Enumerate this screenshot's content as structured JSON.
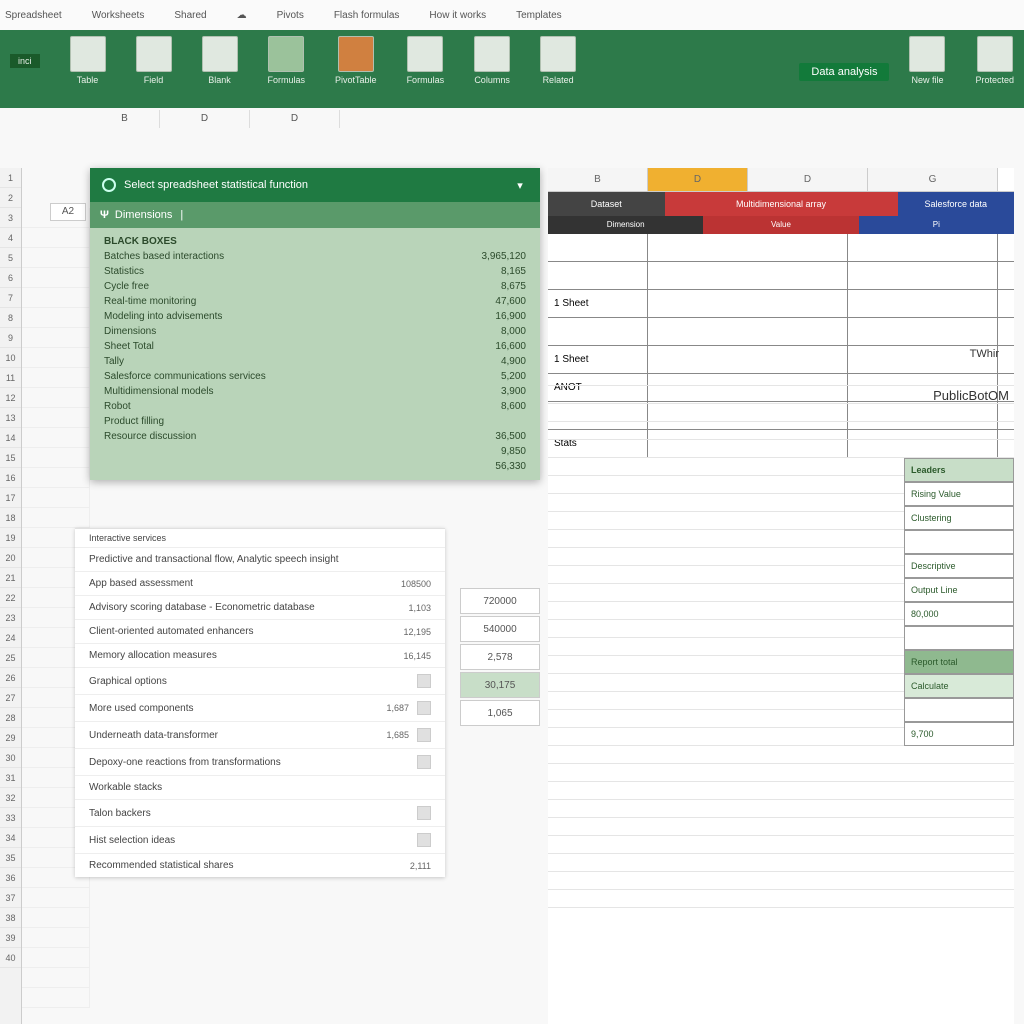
{
  "tabs": [
    "Spreadsheet",
    "Worksheets",
    "Shared",
    "",
    "Pivots",
    "Flash formulas",
    "How it works",
    "Templates"
  ],
  "ribbon": {
    "groups": [
      "Table",
      "Field",
      "Blank",
      "Formulas",
      "PivotTable",
      "Formulas",
      "Columns",
      "Related"
    ],
    "tag": "Data analysis",
    "right_groups": [
      "New file",
      "Protected"
    ]
  },
  "colrow": [
    "B",
    "D",
    "D"
  ],
  "cellref": "A2",
  "dialog": {
    "title": "Select spreadsheet statistical function",
    "filter": "Dimensions",
    "rows": [
      {
        "lbl": "BLACK BOXES",
        "val": ""
      },
      {
        "lbl": "Batches based interactions",
        "val": "3,965,120"
      },
      {
        "lbl": "Statistics",
        "val": "8,165"
      },
      {
        "lbl": "Cycle free",
        "val": "8,675"
      },
      {
        "lbl": "Real-time monitoring",
        "val": "47,600"
      },
      {
        "lbl": "Modeling into advisements",
        "val": "16,900"
      },
      {
        "lbl": "Dimensions",
        "val": "8,000"
      },
      {
        "lbl": "Sheet Total",
        "val": "16,600"
      },
      {
        "lbl": "Tally",
        "val": "4,900"
      },
      {
        "lbl": "Salesforce communications services",
        "val": "5,200"
      },
      {
        "lbl": "Multidimensional models",
        "val": "3,900"
      },
      {
        "lbl": "Robot",
        "val": "8,600"
      },
      {
        "lbl": "Product filling",
        "val": ""
      },
      {
        "lbl": "Resource discussion",
        "val": "36,500"
      },
      {
        "lbl": "",
        "val": "9,850"
      },
      {
        "lbl": "",
        "val": "56,330"
      }
    ]
  },
  "lowerlist": {
    "title": "Interactive services",
    "subtitle": "Predictive and transactional flow, Analytic speech insight",
    "items": [
      {
        "txt": "App based assessment",
        "num": "108500"
      },
      {
        "txt": "Advisory scoring database - Econometric database",
        "num": "1,103"
      },
      {
        "txt": "Client-oriented automated enhancers",
        "num": "12,195"
      },
      {
        "txt": "Memory allocation measures",
        "num": "16,145"
      },
      {
        "txt": "Graphical options",
        "num": ""
      },
      {
        "txt": "More used components",
        "num": "1,687"
      },
      {
        "txt": "Underneath data-transformer",
        "num": "1,685"
      },
      {
        "txt": "Depoxy-one reactions from transformations",
        "num": ""
      },
      {
        "txt": "Workable stacks",
        "num": ""
      },
      {
        "txt": "Talon backers",
        "num": ""
      },
      {
        "txt": "Hist selection ideas",
        "num": ""
      },
      {
        "txt": "Recommended statistical shares",
        "num": "2,111"
      }
    ]
  },
  "sidecol": [
    "720000",
    "540000",
    "2,578",
    "30,175",
    "",
    "1,065"
  ],
  "rgrid": {
    "cols": [
      "B",
      "D",
      "D",
      "G"
    ],
    "tabs": [
      "Dataset",
      "Multidimensional array",
      "Salesforce data"
    ],
    "sub": [
      "Dimension",
      "Value",
      "Pi"
    ],
    "rows": [
      {
        "a": "",
        "b": "",
        "d": ""
      },
      {
        "a": "",
        "b": "",
        "d": ""
      },
      {
        "a": "1 Sheet",
        "b": "",
        "d": ""
      },
      {
        "a": "",
        "b": "",
        "d": ""
      },
      {
        "a": "1 Sheet",
        "b": "",
        "d": ""
      },
      {
        "a": "ANOT",
        "b": "",
        "d": ""
      },
      {
        "a": "",
        "b": "",
        "d": ""
      },
      {
        "a": "Stats",
        "b": "",
        "d": ""
      }
    ]
  },
  "rside": [
    {
      "txt": "Leaders",
      "cls": "hdr"
    },
    {
      "txt": "Rising Value",
      "cls": "white"
    },
    {
      "txt": "Clustering",
      "cls": "white"
    },
    {
      "txt": "",
      "cls": "white"
    },
    {
      "txt": "Descriptive",
      "cls": "white"
    },
    {
      "txt": "Output Line",
      "cls": "white"
    },
    {
      "txt": "80,000",
      "cls": "white"
    },
    {
      "txt": "",
      "cls": "white"
    },
    {
      "txt": "Report total",
      "cls": "dark"
    },
    {
      "txt": "Calculate",
      "cls": "rc"
    },
    {
      "txt": "",
      "cls": "white"
    },
    {
      "txt": "9,700",
      "cls": "white"
    }
  ],
  "rlabel1": "TWhir",
  "rlabel2": "PublicBotOM"
}
